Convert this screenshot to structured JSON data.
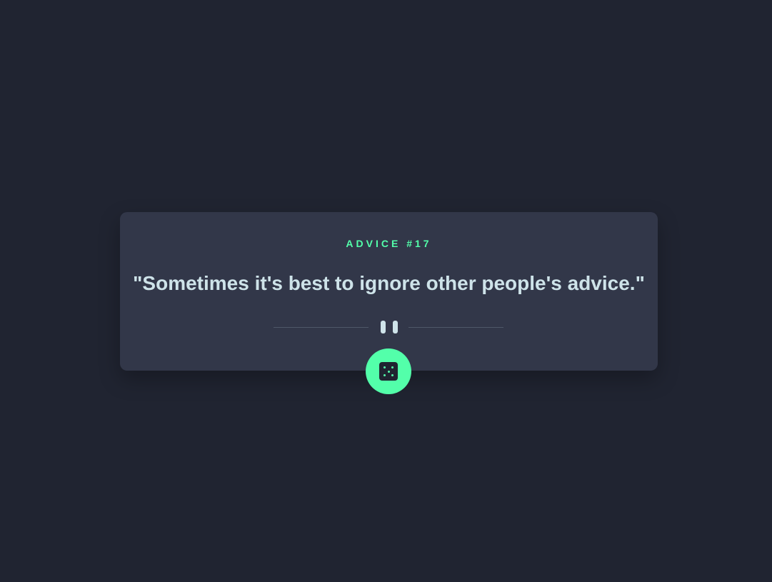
{
  "advice": {
    "title": "ADVICE #17",
    "quote": "\"Sometimes it's best to ignore other people's advice.\""
  },
  "icons": {
    "divider": "pause-icon",
    "button": "dice-icon"
  },
  "colors": {
    "background": "#202431",
    "card": "#323749",
    "accent": "#53ffaa",
    "text": "#cee3e9",
    "divider": "#4f5869"
  }
}
